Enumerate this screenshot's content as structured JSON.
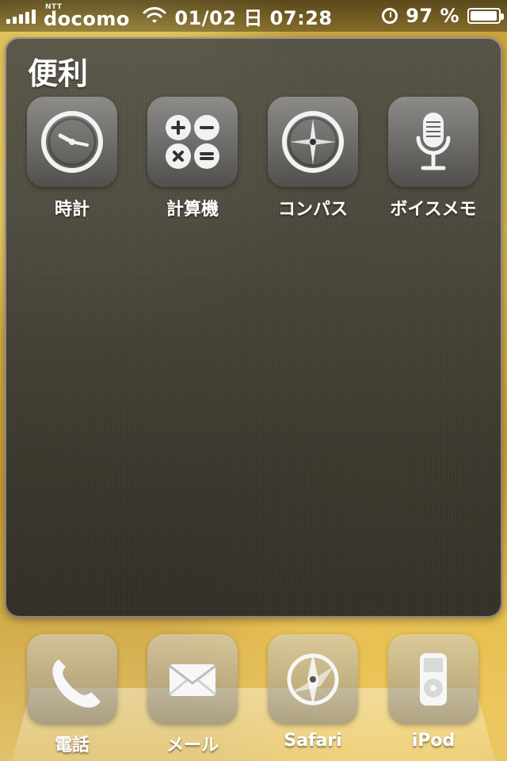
{
  "status_bar": {
    "carrier_small": "NTT",
    "carrier": "docomo",
    "time": "01/02 日 07:28",
    "battery": "97 %",
    "battery_level": 0.97
  },
  "folder": {
    "title": "便利",
    "apps": [
      {
        "label": "時計",
        "icon": "clock-icon"
      },
      {
        "label": "計算機",
        "icon": "calculator-icon"
      },
      {
        "label": "コンパス",
        "icon": "compass-icon"
      },
      {
        "label": "ボイスメモ",
        "icon": "microphone-icon"
      }
    ]
  },
  "dock": {
    "apps": [
      {
        "label": "電話",
        "icon": "phone-icon"
      },
      {
        "label": "メール",
        "icon": "mail-icon"
      },
      {
        "label": "Safari",
        "icon": "safari-icon"
      },
      {
        "label": "iPod",
        "icon": "ipod-icon"
      }
    ]
  }
}
